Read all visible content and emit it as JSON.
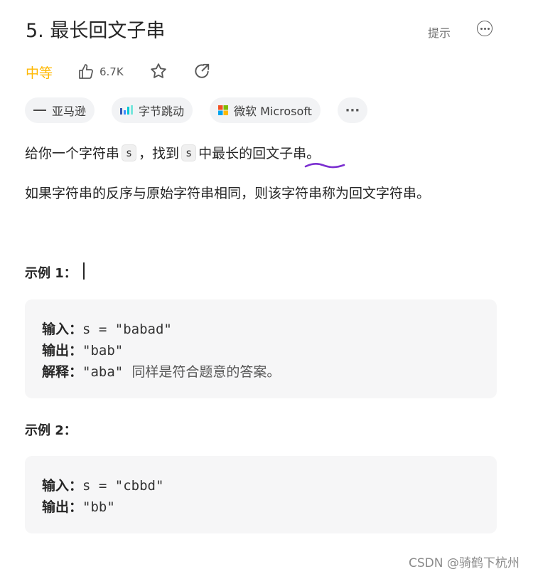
{
  "problem": {
    "title": "5. 最长回文子串",
    "hint_label": "提示",
    "difficulty": "中等",
    "like_count": "6.7K"
  },
  "tags": [
    {
      "label": "亚马逊",
      "icon": "amazon-icon"
    },
    {
      "label": "字节跳动",
      "icon": "bytedance-icon"
    },
    {
      "label": "微软 Microsoft",
      "icon": "microsoft-icon"
    },
    {
      "label": "···",
      "icon": "more-icon"
    }
  ],
  "description": {
    "line1_a": "给你一个字符串",
    "line1_code1": "s",
    "line1_b": "，找到",
    "line1_code2": "s",
    "line1_c": "中最长的回文子串。",
    "line2": "如果字符串的反序与原始字符串相同，则该字符串称为回文字符串。"
  },
  "examples": [
    {
      "title": "示例 1：",
      "input_label": "输入：",
      "input_value": "s = \"babad\"",
      "output_label": "输出：",
      "output_value": "\"bab\"",
      "explain_label": "解释：",
      "explain_value": "\"aba\"",
      "explain_text": "同样是符合题意的答案。"
    },
    {
      "title": "示例 2：",
      "input_label": "输入：",
      "input_value": "s = \"cbbd\"",
      "output_label": "输出：",
      "output_value": "\"bb\""
    }
  ],
  "watermark": "CSDN @骑鹤下杭州",
  "colors": {
    "difficulty_medium": "#ffb800",
    "annotation_underline": "#7b2fd0",
    "example_bg": "#f6f6f7"
  }
}
